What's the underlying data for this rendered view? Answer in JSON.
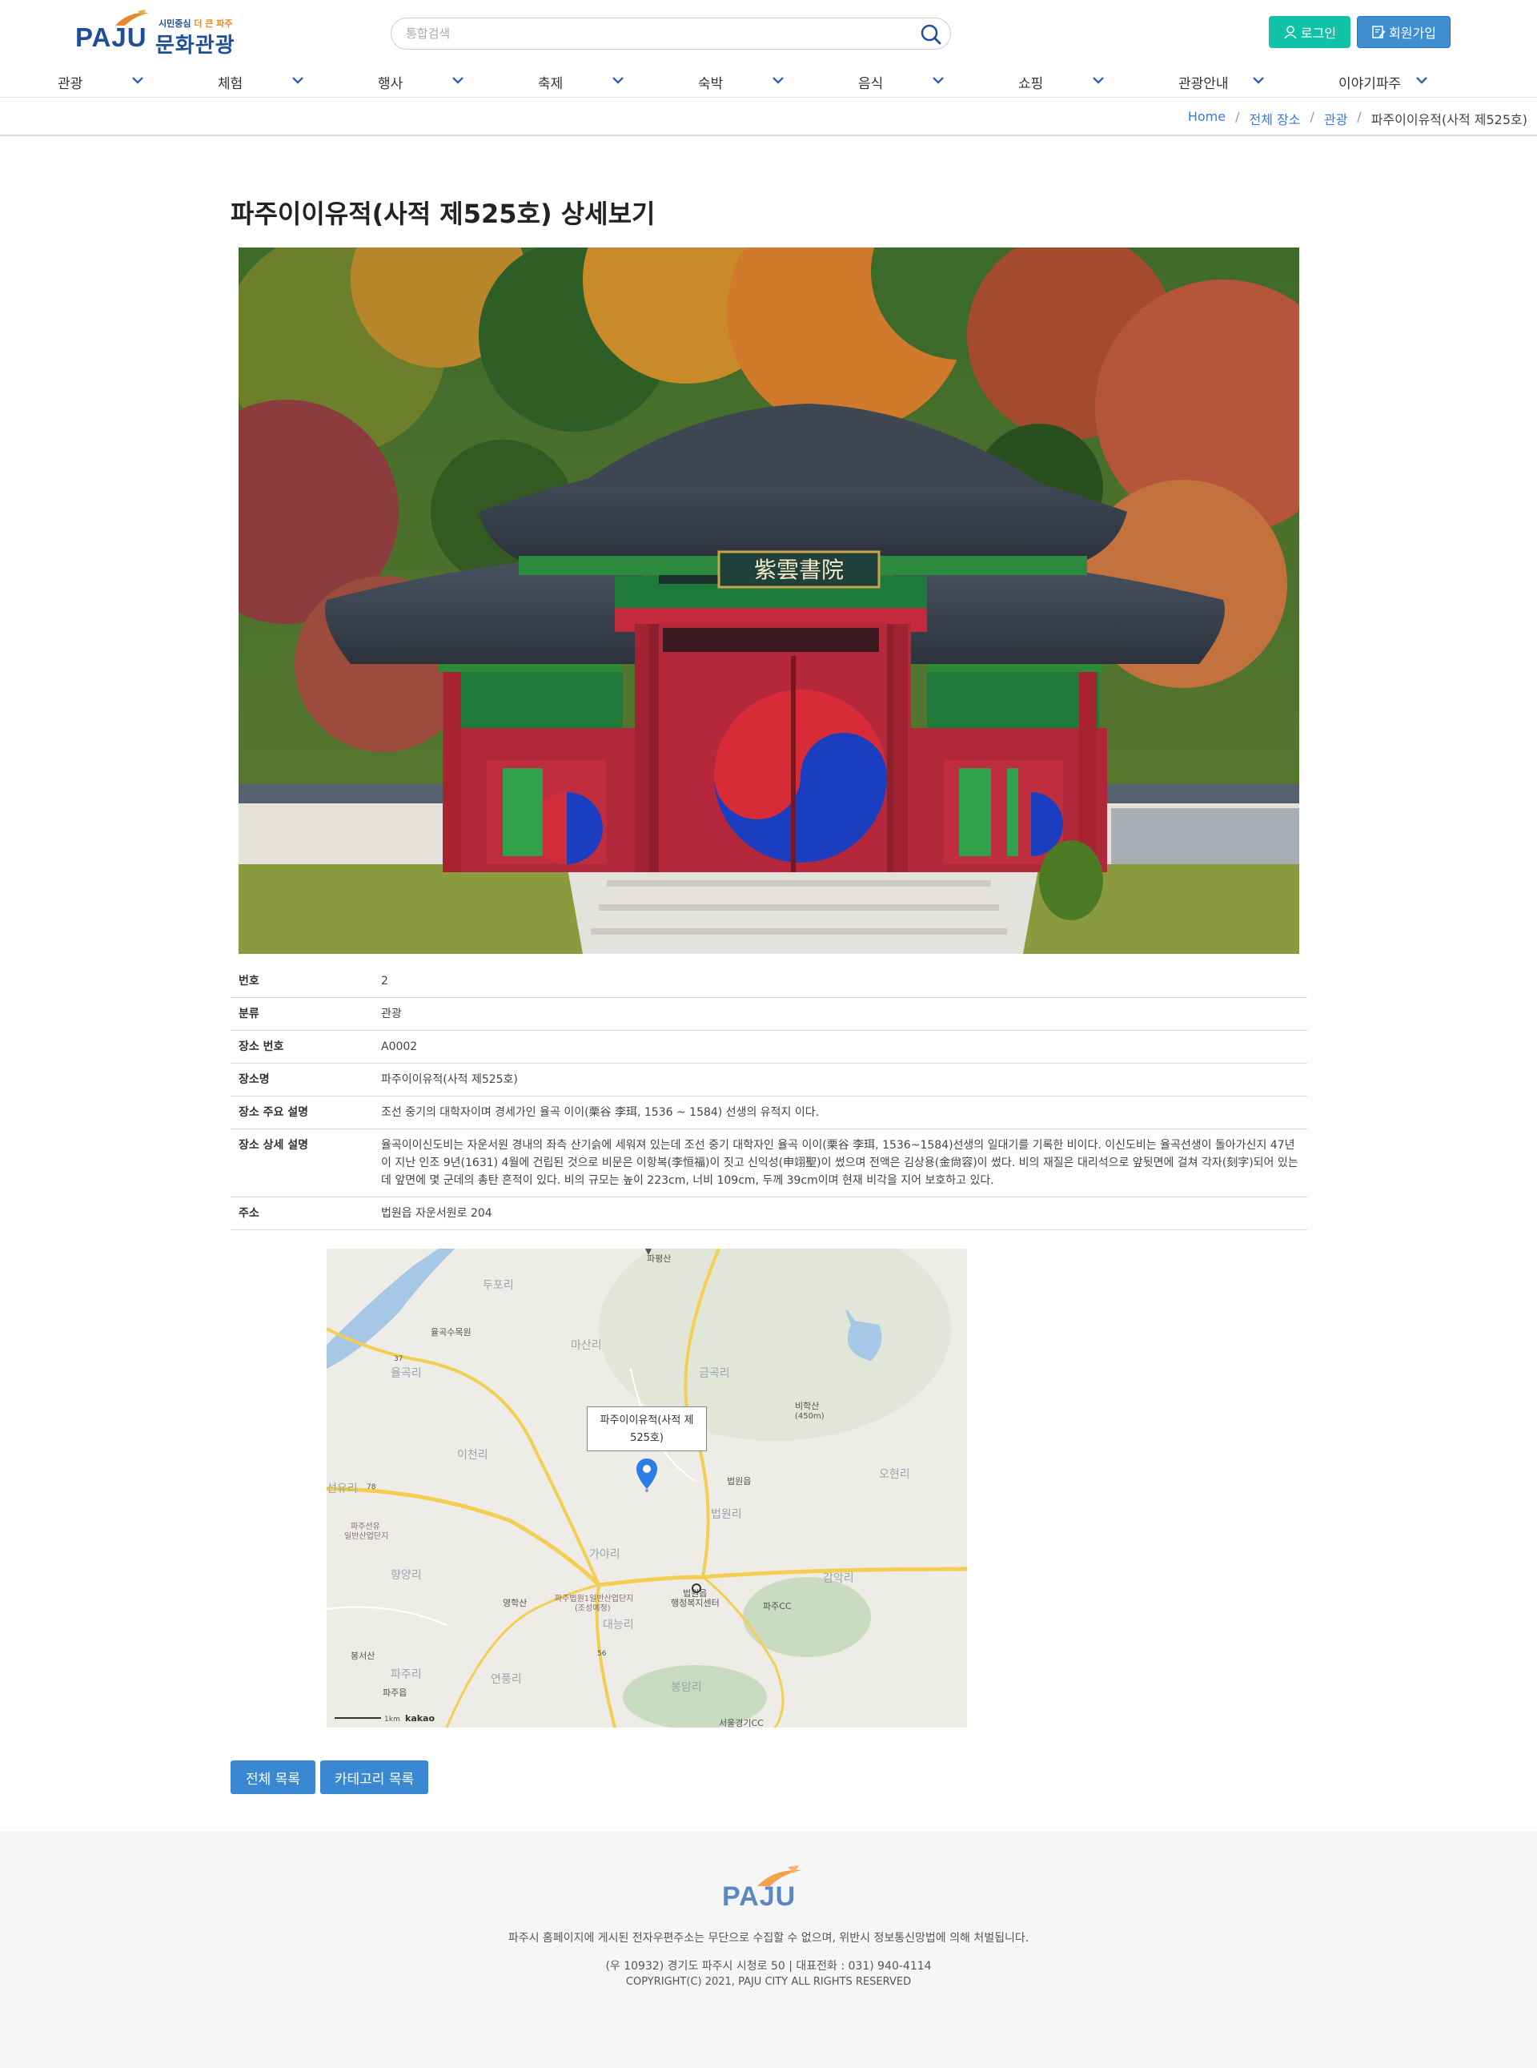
{
  "header": {
    "logo_text": "PAJU",
    "logo_slogan_a": "시민중심",
    "logo_slogan_b": "더 큰 파주",
    "logo_subtitle": "문화관광",
    "search_placeholder": "통합검색",
    "login_label": "로그인",
    "join_label": "회원가입"
  },
  "nav": {
    "items": [
      {
        "label": "관광"
      },
      {
        "label": "체험"
      },
      {
        "label": "행사"
      },
      {
        "label": "축제"
      },
      {
        "label": "숙박"
      },
      {
        "label": "음식"
      },
      {
        "label": "쇼핑"
      },
      {
        "label": "관광안내"
      },
      {
        "label": "이야기파주"
      }
    ]
  },
  "breadcrumb": {
    "home": "Home",
    "all_places": "전체 장소",
    "category": "관광",
    "current": "파주이이유적(사적 제525호)"
  },
  "page": {
    "title": "파주이이유적(사적 제525호) 상세보기",
    "photo_sign": "紫雲書院"
  },
  "details": {
    "rows": [
      {
        "label": "번호",
        "value": "2"
      },
      {
        "label": "분류",
        "value": "관광"
      },
      {
        "label": "장소 번호",
        "value": "A0002"
      },
      {
        "label": "장소명",
        "value": "파주이이유적(사적 제525호)"
      },
      {
        "label": "장소 주요 설명",
        "value": "조선 중기의 대학자이며 경세가인 율곡 이이(栗谷 李珥, 1536 ~ 1584) 선생의 유적지 이다."
      },
      {
        "label": "장소 상세 설명",
        "value": "율곡이이신도비는 자운서원 경내의 좌측 산기슭에 세워져 있는데 조선 중기 대학자인 율곡 이이(栗谷 李珥, 1536~1584)선생의 일대기를 기록한 비이다. 이신도비는 율곡선생이 돌아가신지 47년이 지난 인조 9년(1631) 4월에 건립된 것으로 비문은 이항복(李恒福)이 짓고 신익성(申翊聖)이 썼으며 전액은 김상용(金尙容)이 썼다. 비의 재질은 대리석으로 앞뒷면에 걸쳐 각자(刻字)되어 있는데 앞면에 몇 군데의 총탄 흔적이 있다. 비의 규모는 높이 223cm, 너비 109cm, 두께 39cm이며 현재 비각을 지어 보호하고 있다."
      },
      {
        "label": "주소",
        "value": "법원읍 자운서원로 204"
      }
    ]
  },
  "map": {
    "tooltip_line1": "파주이이유적(사적 제",
    "tooltip_line2": "525호)",
    "labels": {
      "mountain_top": "파평산",
      "dupo": "두포리",
      "yulgok_su": "율곡수목원",
      "road37": "37",
      "yulgok": "율곡리",
      "masan": "마산리",
      "geumgok": "금곡리",
      "bihak": "비학산",
      "bihak_h": "(450m)",
      "icheon": "이천리",
      "ohyeon": "오현리",
      "road78": "78",
      "bubwon": "법원읍",
      "bubwonri": "법원리",
      "seonyu": "선유리",
      "seonyu_ind_a": "파주선유",
      "seonyu_ind_b": "일반산업단지",
      "gaya": "가야리",
      "hyangyang": "향양리",
      "center_a": "법원읍",
      "center_b": "행정복지센터",
      "gamak": "감악리",
      "paju_cc": "파주CC",
      "yeonghak": "영학산",
      "bubwon_ind_a": "파주법원1일반산업단지",
      "bubwon_ind_b": "(조성예정)",
      "daeneung": "대능리",
      "road56": "56",
      "bongseo": "봉서산",
      "pajuri": "파주리",
      "yeonpung": "연풍리",
      "bongamri": "봉암리",
      "pajueup": "파주읍",
      "seoul_cc": "서울경기CC",
      "scale": "1km",
      "brand": "kakao"
    }
  },
  "buttons": {
    "all_list": "전체 목록",
    "category_list": "카테고리 목록"
  },
  "footer": {
    "logo": "PAJU",
    "notice": "파주시 홈페이지에 게시된 전자우편주소는 무단으로 수집할 수 없으며, 위반시 정보통신망법에 의해 처벌됩니다.",
    "address": "(우 10932) 경기도 파주시 시청로 50 | 대표전화 : 031) 940-4114",
    "copyright": "COPYRIGHT(C) 2021, PAJU CITY ALL RIGHTS RESERVED"
  },
  "colors": {
    "brand_blue": "#1f4f99",
    "login_teal": "#12c2a6",
    "join_blue": "#3f8ed1",
    "link_blue": "#3a7bd5",
    "button_blue": "#3a87d2"
  }
}
